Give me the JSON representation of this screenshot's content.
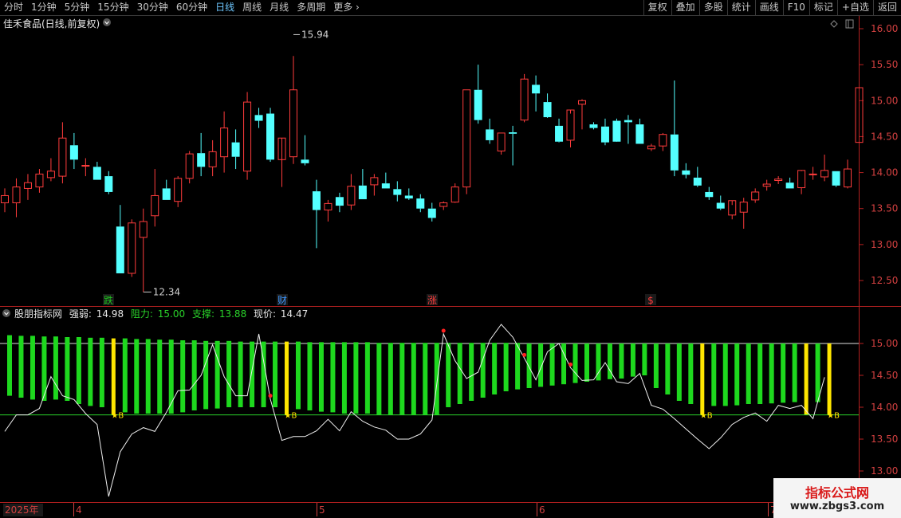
{
  "toolbar": {
    "periods": [
      "分时",
      "1分钟",
      "5分钟",
      "15分钟",
      "30分钟",
      "60分钟",
      "日线",
      "周线",
      "月线",
      "多周期",
      "更多"
    ],
    "active_period": "日线",
    "more_chevron": "chevron-right-icon",
    "right_buttons": [
      "复权",
      "叠加",
      "多股",
      "统计",
      "画线",
      "F10",
      "标记",
      "+自选",
      "返回"
    ]
  },
  "main_panel": {
    "title": "佳禾食品(日线,前复权)",
    "high_marker": "15.94",
    "low_marker": "12.34",
    "event_labels": [
      {
        "text": "跌",
        "color": "#1ec81e"
      },
      {
        "text": "财",
        "color": "#3c96ff"
      },
      {
        "text": "涨",
        "color": "#ff3c3c"
      },
      {
        "text": "$",
        "color": "#ff3c3c"
      }
    ]
  },
  "indicator_panel": {
    "name": "股朋指标网",
    "strength_label": "强弱:",
    "strength_value": "14.98",
    "resist_label": "阻力:",
    "resist_value": "15.00",
    "support_label": "支撑:",
    "support_value": "13.88",
    "price_label": "现价:",
    "price_value": "14.47",
    "buy_marker": "B"
  },
  "time_axis": {
    "year": "2025年",
    "months": [
      "4",
      "5",
      "6",
      "7"
    ]
  },
  "watermark": {
    "line1": "指标公式网",
    "line2": "www.zbgs3.com"
  },
  "colors": {
    "up": "#ff3c3c",
    "down": "#54ffff",
    "green_bar": "#1ed81e",
    "yellow_bar": "#ffe600",
    "support": "#2ad42a"
  },
  "chart_data": [
    {
      "type": "candlestick",
      "ylim": [
        12.3,
        16.1
      ],
      "yticks": [
        "16.00",
        "15.50",
        "15.00",
        "14.50",
        "14.00",
        "13.50",
        "13.00",
        "12.50"
      ],
      "ohlc": [
        [
          13.58,
          13.78,
          13.45,
          13.68
        ],
        [
          13.58,
          13.92,
          13.38,
          13.8
        ],
        [
          13.78,
          13.98,
          13.62,
          13.86
        ],
        [
          13.8,
          14.05,
          13.72,
          13.98
        ],
        [
          13.93,
          14.2,
          13.88,
          14.02
        ],
        [
          13.95,
          14.7,
          13.85,
          14.48
        ],
        [
          14.38,
          14.55,
          14.05,
          14.18
        ],
        [
          14.1,
          14.2,
          13.95,
          14.1
        ],
        [
          14.08,
          14.15,
          13.9,
          13.9
        ],
        [
          13.95,
          14.02,
          13.7,
          13.73
        ],
        [
          13.25,
          13.55,
          12.6,
          12.6
        ],
        [
          12.6,
          13.35,
          12.55,
          13.3
        ],
        [
          13.1,
          13.5,
          12.34,
          13.32
        ],
        [
          13.4,
          14.05,
          13.25,
          13.68
        ],
        [
          13.78,
          13.9,
          13.62,
          13.62
        ],
        [
          13.6,
          13.95,
          13.52,
          13.92
        ],
        [
          13.92,
          14.3,
          13.85,
          14.26
        ],
        [
          14.27,
          14.55,
          13.95,
          14.08
        ],
        [
          14.08,
          14.45,
          13.95,
          14.29
        ],
        [
          14.22,
          14.85,
          14.0,
          14.62
        ],
        [
          14.42,
          14.6,
          14.05,
          14.22
        ],
        [
          14.02,
          15.12,
          13.9,
          14.98
        ],
        [
          14.8,
          14.9,
          14.62,
          14.72
        ],
        [
          14.82,
          14.9,
          14.15,
          14.18
        ],
        [
          14.18,
          14.18,
          13.8,
          14.48
        ],
        [
          14.22,
          15.62,
          14.12,
          15.15
        ],
        [
          14.18,
          14.52,
          14.1,
          14.13
        ],
        [
          13.74,
          13.9,
          12.95,
          13.48
        ],
        [
          13.48,
          13.62,
          13.32,
          13.57
        ],
        [
          13.66,
          13.72,
          13.45,
          13.54
        ],
        [
          13.55,
          13.98,
          13.48,
          13.81
        ],
        [
          13.82,
          14.05,
          13.7,
          13.63
        ],
        [
          13.83,
          13.98,
          13.68,
          13.93
        ],
        [
          13.85,
          14.0,
          13.78,
          13.78
        ],
        [
          13.77,
          13.88,
          13.6,
          13.69
        ],
        [
          13.68,
          13.78,
          13.62,
          13.64
        ],
        [
          13.64,
          13.7,
          13.45,
          13.5
        ],
        [
          13.5,
          13.58,
          13.32,
          13.37
        ],
        [
          13.53,
          13.6,
          13.48,
          13.58
        ],
        [
          13.59,
          13.85,
          13.58,
          13.8
        ],
        [
          13.8,
          15.15,
          13.7,
          15.15
        ],
        [
          15.15,
          15.5,
          14.68,
          14.73
        ],
        [
          14.6,
          14.75,
          14.4,
          14.45
        ],
        [
          14.3,
          14.55,
          14.25,
          14.55
        ],
        [
          14.56,
          14.65,
          14.1,
          14.54
        ],
        [
          14.73,
          15.37,
          14.7,
          15.3
        ],
        [
          15.22,
          15.35,
          14.85,
          15.1
        ],
        [
          14.98,
          15.1,
          14.76,
          14.77
        ],
        [
          14.65,
          14.75,
          14.42,
          14.43
        ],
        [
          14.45,
          14.82,
          14.35,
          14.87
        ],
        [
          14.95,
          15.02,
          14.6,
          15.0
        ],
        [
          14.67,
          14.7,
          14.6,
          14.62
        ],
        [
          14.64,
          14.75,
          14.38,
          14.42
        ],
        [
          14.72,
          14.75,
          14.45,
          14.43
        ],
        [
          14.73,
          14.8,
          14.4,
          14.7
        ],
        [
          14.67,
          14.75,
          14.4,
          14.4
        ],
        [
          14.33,
          14.4,
          14.3,
          14.37
        ],
        [
          14.37,
          14.55,
          14.3,
          14.53
        ],
        [
          14.53,
          15.28,
          13.95,
          14.03
        ],
        [
          14.03,
          14.13,
          13.92,
          13.97
        ],
        [
          13.93,
          14.08,
          13.8,
          13.82
        ],
        [
          13.73,
          13.8,
          13.62,
          13.66
        ],
        [
          13.58,
          13.68,
          13.48,
          13.5
        ],
        [
          13.41,
          13.55,
          13.35,
          13.61
        ],
        [
          13.45,
          13.65,
          13.22,
          13.59
        ],
        [
          13.62,
          13.78,
          13.58,
          13.73
        ],
        [
          13.81,
          13.9,
          13.75,
          13.84
        ],
        [
          13.89,
          13.95,
          13.84,
          13.91
        ],
        [
          13.86,
          13.93,
          13.78,
          13.78
        ],
        [
          13.79,
          14.02,
          13.7,
          14.03
        ],
        [
          13.98,
          14.08,
          13.9,
          13.98
        ],
        [
          13.94,
          14.25,
          13.88,
          14.03
        ],
        [
          14.02,
          14.02,
          13.8,
          13.82
        ],
        [
          13.8,
          14.18,
          13.78,
          14.05
        ],
        [
          14.42,
          15.18,
          14.42,
          15.18
        ]
      ]
    },
    {
      "type": "indicator",
      "ylim": [
        12.8,
        15.6
      ],
      "yticks": [
        "15.00",
        "14.50",
        "14.00",
        "13.50",
        "13.00"
      ],
      "resistance_line": 15.0,
      "support_line": 13.88,
      "strength_line": [
        13.62,
        13.88,
        13.88,
        13.98,
        14.48,
        14.18,
        14.12,
        13.9,
        13.73,
        12.6,
        13.3,
        13.58,
        13.68,
        13.62,
        13.92,
        14.26,
        14.27,
        14.5,
        14.98,
        14.48,
        14.18,
        14.18,
        15.15,
        14.13,
        13.48,
        13.54,
        13.54,
        13.63,
        13.81,
        13.63,
        13.93,
        13.78,
        13.69,
        13.64,
        13.5,
        13.5,
        13.58,
        13.8,
        15.15,
        14.73,
        14.45,
        14.55,
        15.05,
        15.3,
        15.1,
        14.77,
        14.43,
        14.87,
        15.0,
        14.62,
        14.42,
        14.43,
        14.7,
        14.4,
        14.37,
        14.53,
        14.03,
        13.97,
        13.82,
        13.66,
        13.5,
        13.35,
        13.52,
        13.73,
        13.84,
        13.91,
        13.78,
        14.03,
        13.98,
        14.03,
        13.82,
        14.47
      ],
      "green_bar_bottoms": [
        14.18,
        14.15,
        14.12,
        14.1,
        14.12,
        14.1,
        14.05,
        14.02,
        14.0,
        13.95,
        13.92,
        13.9,
        13.9,
        13.9,
        13.9,
        13.92,
        13.95,
        13.97,
        13.98,
        14.0,
        14.0,
        14.0,
        14.0,
        14.0,
        13.98,
        13.97,
        13.95,
        13.93,
        13.92,
        13.9,
        13.9,
        13.9,
        13.88,
        13.88,
        13.88,
        13.88,
        13.88,
        13.88,
        14.0,
        14.05,
        14.1,
        14.15,
        14.2,
        14.25,
        14.28,
        14.3,
        14.32,
        14.34,
        14.36,
        14.38,
        14.4,
        14.42,
        14.44,
        14.45,
        14.48,
        14.5,
        14.3,
        14.2,
        14.1,
        14.05,
        14.03,
        14.02,
        14.02,
        14.03,
        14.05,
        14.05,
        14.06,
        14.07,
        14.08,
        14.08,
        14.08,
        14.08
      ],
      "green_bar_tops": [
        15.13,
        15.12,
        15.12,
        15.11,
        15.11,
        15.1,
        15.1,
        15.09,
        15.09,
        15.08,
        15.08,
        15.07,
        15.07,
        15.06,
        15.06,
        15.05,
        15.05,
        15.04,
        15.04,
        15.04,
        15.03,
        15.03,
        15.03,
        15.03,
        15.03,
        15.03,
        15.02,
        15.02,
        15.02,
        15.02,
        15.02,
        15.02,
        15.01,
        15.01,
        15.01,
        15.01,
        15.01,
        15.01,
        15.01,
        15.01,
        15.01,
        15.01,
        15.01,
        15.01,
        15.01,
        15.0,
        15.0,
        15.0,
        15.0,
        15.0,
        15.0,
        15.0,
        15.0,
        15.0,
        15.0,
        15.0,
        15.0,
        15.0,
        15.0,
        15.0,
        15.0,
        15.0,
        15.0,
        15.0,
        15.0,
        15.0,
        15.0,
        15.0,
        15.0,
        15.0,
        15.0,
        15.0
      ],
      "yellow_bar_indices": [
        9,
        24,
        60,
        69,
        71
      ],
      "red_star_indices": [
        23,
        38,
        45,
        49
      ],
      "buy_marker_indices": [
        9,
        24,
        60,
        71
      ]
    }
  ]
}
